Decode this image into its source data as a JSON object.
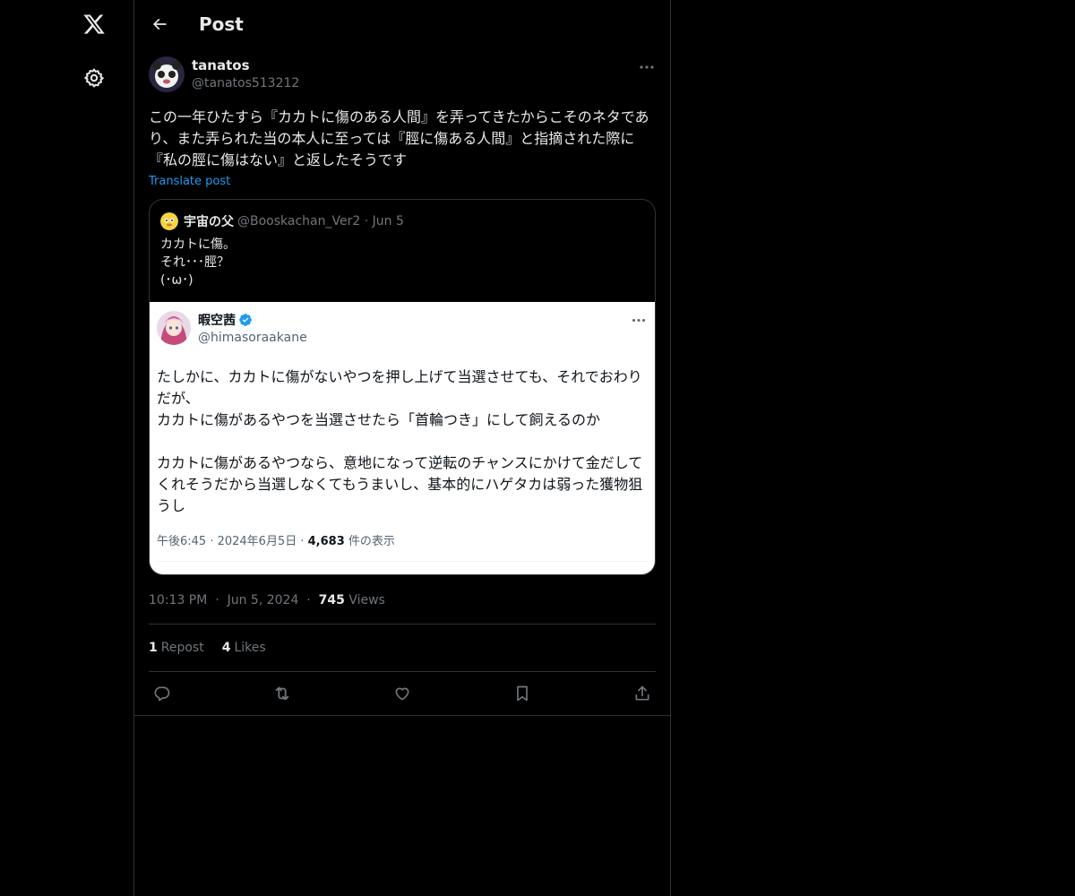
{
  "nav": {
    "logo_icon": "x-logo-icon",
    "settings_icon": "gear-icon"
  },
  "header": {
    "title": "Post"
  },
  "post": {
    "author_name": "tanatos",
    "author_handle": "@tanatos513212",
    "text": "この一年ひたすら『カカトに傷のある人間』を弄ってきたからこそのネタであり、また弄られた当の本人に至っては『脛に傷ある人間』と指摘された際に『私の脛に傷はない』と返したそうです",
    "translate_label": "Translate post",
    "quote": {
      "author_name": "宇宙の父",
      "author_handle": "@Booskachan_Ver2",
      "date": "Jun 5",
      "text": "カカトに傷。\nそれ･･･脛？\n(･ω･)",
      "embed": {
        "author_name": "暇空茜",
        "author_handle": "@himasoraakane",
        "text": "たしかに、カカトに傷がないやつを押し上げて当選させても、それでおわりだが、\nカカトに傷があるやつを当選させたら「首輪つき」にして飼えるのか\n\nカカトに傷があるやつなら、意地になって逆転のチャンスにかけて金だしてくれそうだから当選しなくてもうまいし、基本的にハゲタカは弱った獲物狙うし",
        "time": "午後6:45 · 2024年6月5日 · ",
        "views": "4,683",
        "views_label": " 件の表示"
      }
    },
    "time": "10:13 PM",
    "date": "Jun 5, 2024",
    "views": "745",
    "views_label": "Views",
    "reposts": "1",
    "reposts_label": "Repost",
    "likes": "4",
    "likes_label": "Likes"
  },
  "colors": {
    "accent": "#1d9bf0",
    "background": "#000000",
    "border": "#2f3336"
  }
}
